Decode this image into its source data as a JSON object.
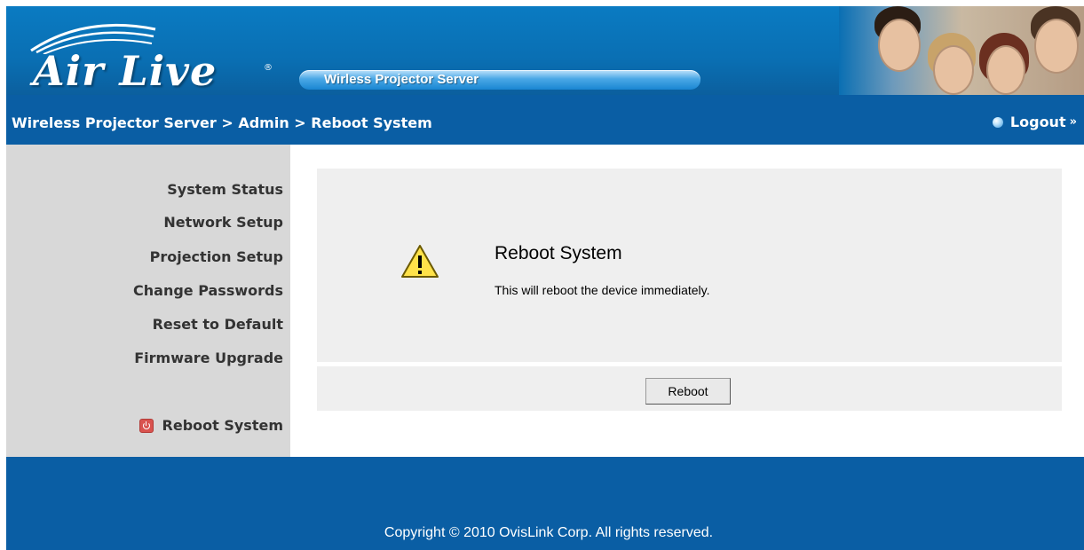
{
  "brand": {
    "logo_text": "Air Live",
    "logo_mark": "®",
    "product_label": "Wirless Projector Server"
  },
  "navbar": {
    "breadcrumb": "Wireless Projector Server > Admin > Reboot System",
    "logout_label": "Logout",
    "logout_arrows": "»"
  },
  "sidebar": {
    "items": [
      {
        "label": "System Status"
      },
      {
        "label": "Network Setup"
      },
      {
        "label": "Projection Setup"
      },
      {
        "label": "Change Passwords"
      },
      {
        "label": "Reset to Default"
      },
      {
        "label": "Firmware Upgrade"
      }
    ],
    "reboot_label": "Reboot System",
    "reboot_icon": "power-icon"
  },
  "panel": {
    "title": "Reboot System",
    "description": "This will reboot the device immediately.",
    "icon": "warning-icon",
    "button_label": "Reboot"
  },
  "footer": {
    "copyright": "Copyright © 2010 OvisLink Corp. All rights reserved."
  },
  "colors": {
    "header_blue": "#0a6fb3",
    "nav_blue": "#0a5ea4",
    "sidebar_gray": "#d8d8d8",
    "panel_gray": "#efefef"
  }
}
